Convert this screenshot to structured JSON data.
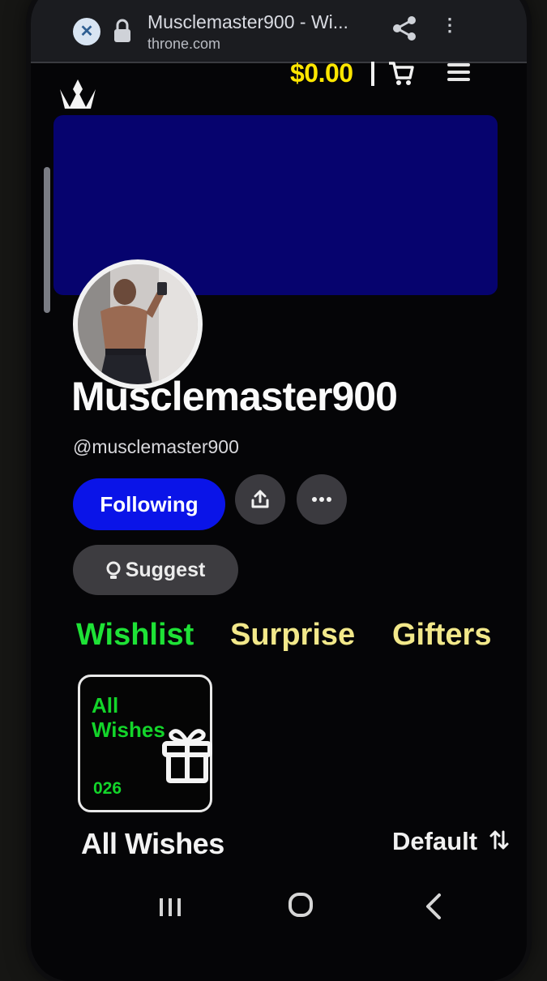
{
  "browser": {
    "tab_title": "Musclemaster900 - Wi...",
    "domain": "throne.com"
  },
  "header": {
    "balance": "$0.00"
  },
  "profile": {
    "display_name": "Musclemaster900",
    "handle": "@musclemaster900",
    "following_label": "Following",
    "suggest_label": "Suggest"
  },
  "tabs": [
    {
      "label": "Wishlist",
      "active": true
    },
    {
      "label": "Surprise",
      "active": false
    },
    {
      "label": "Gifters",
      "active": false
    }
  ],
  "wish_card": {
    "title": "All Wishes",
    "count": "026"
  },
  "section": {
    "title": "All Wishes",
    "sort_label": "Default"
  },
  "colors": {
    "banner": "#06036e",
    "balance": "#ffe600",
    "following_button": "#0a14e8",
    "active_tab": "#1ee236",
    "inactive_tab": "#f2e88a",
    "wish_card_text": "#13d52a"
  },
  "icons": {
    "url_close": "close-icon",
    "url_lock": "lock-icon",
    "url_share": "share-icon",
    "logo": "crown-logo-icon",
    "cart": "cart-icon",
    "menu": "hamburger-menu-icon",
    "share_profile": "upload-share-icon",
    "more": "more-horizontal-icon",
    "suggest": "lightbulb-icon",
    "gift": "gift-icon",
    "sort": "sort-arrows-icon"
  }
}
